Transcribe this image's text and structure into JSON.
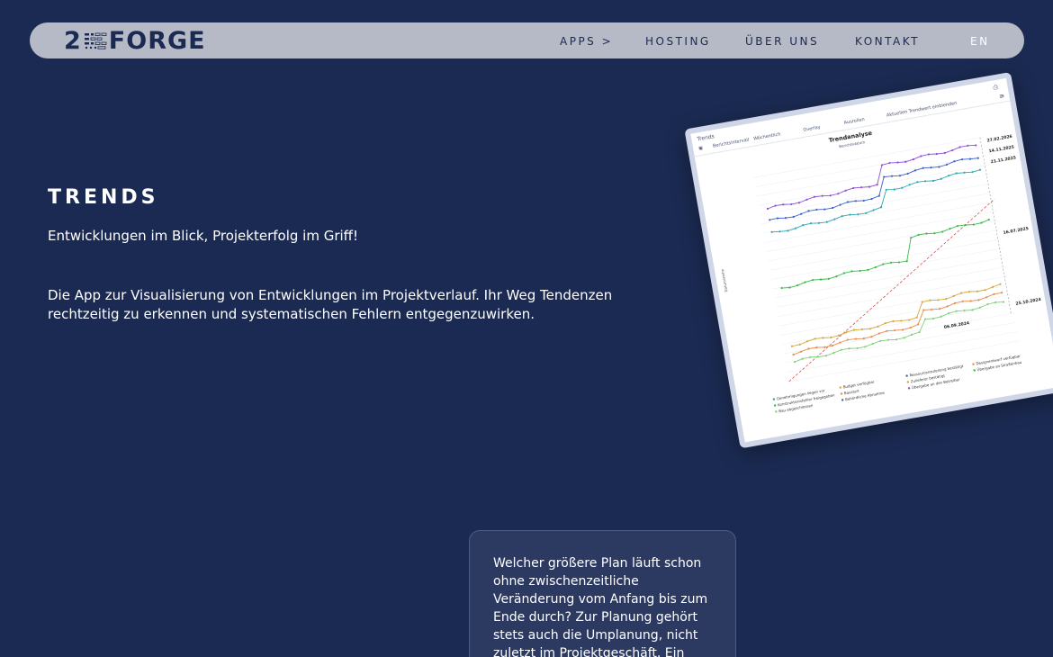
{
  "brand": {
    "number": "2",
    "word": "FORGE"
  },
  "nav": {
    "apps": "APPS >",
    "hosting": "HOSTING",
    "about": "ÜBER UNS",
    "contact": "KONTAKT",
    "lang": "EN"
  },
  "hero": {
    "title": "TRENDS",
    "tagline": "Entwicklungen im Blick, Projekterfolg im Griff!",
    "description": "Die App zur Visualisierung von Entwicklungen im Projektverlauf. Ihr Weg Tendenzen rechtzeitig zu erkennen und systematischen Fehlern entgegenzuwirken."
  },
  "app_preview": {
    "window_title": "Trends",
    "toolbar": {
      "interval_label": "Berichtsintervall",
      "interval_value": "Wöchentlich",
      "overlay_label": "Overlay",
      "auto_label": "Ausrollen",
      "current_label": "Aktuellen Trendwert einblenden"
    },
    "chart_title": "Trendanalyse",
    "chart_subtitle": "Berichtsdatum",
    "y_axis_label": "Datumsreihe",
    "colors": {
      "purple": "#8e4fd6",
      "blue": "#3a5fc8",
      "teal": "#2fa7b0",
      "green": "#3fb84a",
      "gold": "#d6a83a",
      "orange": "#e88c4a",
      "lightgreen": "#7fd17a",
      "diagonal": "#d63a3a"
    },
    "end_labels": [
      "27.02.2026",
      "14.11.2025",
      "21.11.2025",
      "16.07.2025",
      "25.10.2024"
    ],
    "mid_label": "06.09.2024",
    "legend": [
      "Genehmigungen liegen vor",
      "Konstruktionsfehler freigegeben",
      "Bau abgeschlossen",
      "Budget verfügbar",
      "Baustart",
      "Behördliche Abnahme",
      "Ressourcenzuteilung bestätigt",
      "Zulieferer bestätigt",
      "Übergabe an den Betreiber",
      "Designentwurf verfügbar",
      "Übergabe an Straßenbau"
    ]
  },
  "info_card": {
    "text": "Welcher größere Plan läuft schon ohne zwischenzeitliche Veränderung vom Anfang bis zum Ende durch? Zur Planung gehört stets auch die Umplanung, nicht zuletzt im Projektgeschäft. Ein"
  }
}
